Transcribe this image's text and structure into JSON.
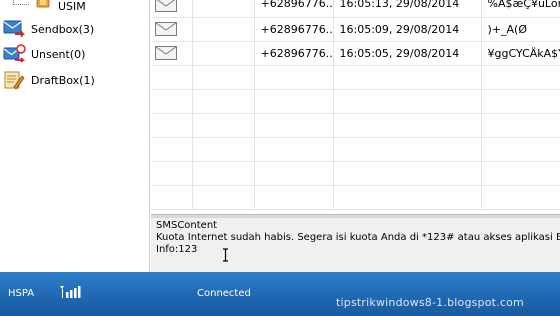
{
  "folders": [
    {
      "label": "USIM"
    },
    {
      "label": "Sendbox(3)"
    },
    {
      "label": "Unsent(0)"
    },
    {
      "label": "DraftBox(1)"
    }
  ],
  "messages": [
    {
      "number": "+62896776...",
      "time": "16:05:13, 29/08/2014",
      "content": "%A$æÇ¥uLom"
    },
    {
      "number": "+62896776...",
      "time": "16:05:09, 29/08/2014",
      "content": ")+_A(Ø"
    },
    {
      "number": "+62896776...",
      "time": "16:05:05, 29/08/2014",
      "content": "¥ggCYCÄkA$YC"
    }
  ],
  "content_panel": {
    "title": "SMSContent",
    "line1": "Kuota Internet sudah habis. Segera isi kuota Anda di *123# atau akses aplikasi Bima",
    "line2": "Info:123"
  },
  "status_bar": {
    "network": "HSPA",
    "connection": "Connected",
    "watermark": "tipstrikwindows8-1.blogspot.com"
  },
  "colors": {
    "status_bar": "#1f66b0",
    "grid": "#e4e4e4",
    "content_bg": "#f0f0f0"
  },
  "icons": [
    "sim-icon",
    "sendbox-icon",
    "unsent-icon",
    "draftbox-icon",
    "envelope-icon",
    "signal-icon",
    "text-cursor-icon"
  ]
}
